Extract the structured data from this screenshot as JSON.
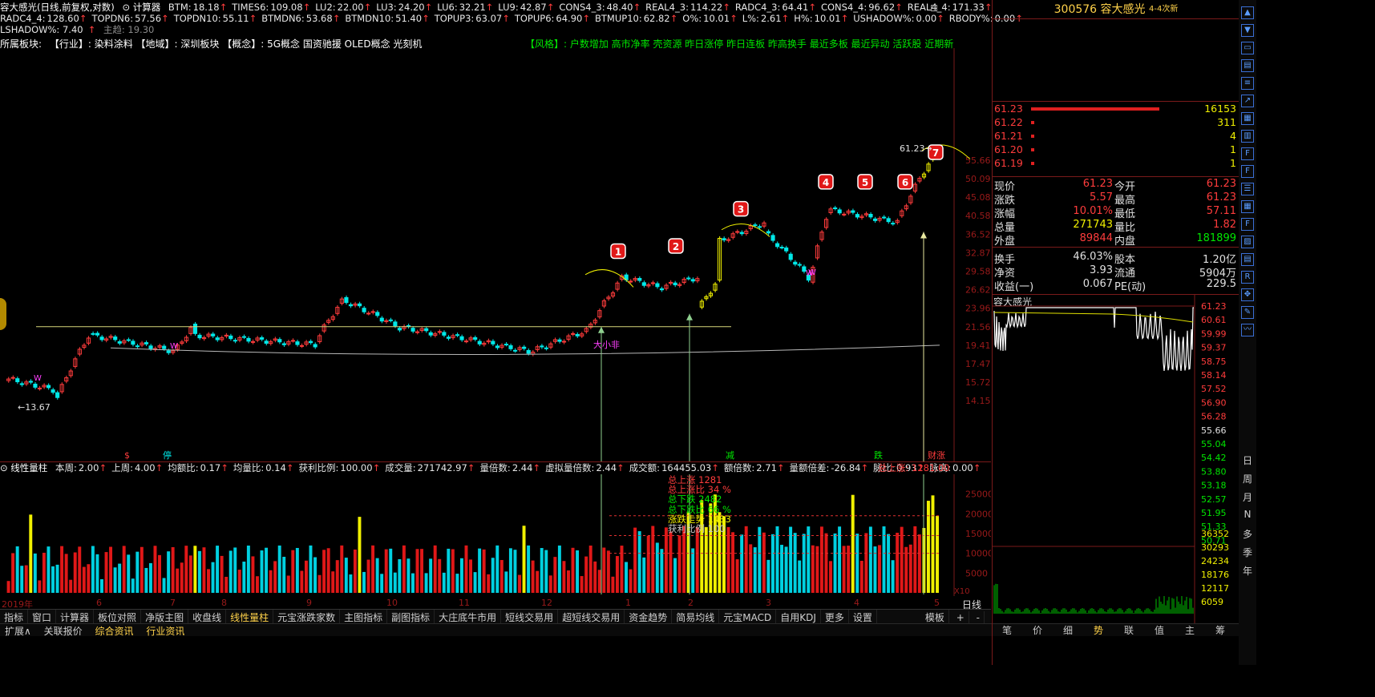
{
  "header": {
    "title": "容大感光(日线,前复权,对数)",
    "calc_label": "计算器",
    "line1": [
      {
        "name": "BTM:",
        "value": "18.18"
      },
      {
        "name": "TIMES6:",
        "value": "109.08"
      },
      {
        "name": "LU2:",
        "value": "22.00"
      },
      {
        "name": "LU3:",
        "value": "24.20"
      },
      {
        "name": "LU6:",
        "value": "32.21"
      },
      {
        "name": "LU9:",
        "value": "42.87"
      },
      {
        "name": "CONS4_3:",
        "value": "48.40"
      },
      {
        "name": "REAL4_3:",
        "value": "114.22"
      },
      {
        "name": "RADC4_3:",
        "value": "64.41"
      },
      {
        "name": "CONS4_4:",
        "value": "96.62"
      },
      {
        "name": "REAL4_4:",
        "value": "171.33"
      }
    ],
    "line2": [
      {
        "name": "RADC4_4:",
        "value": "128.60"
      },
      {
        "name": "TOPDN6:",
        "value": "57.56"
      },
      {
        "name": "TOPDN10:",
        "value": "55.11"
      },
      {
        "name": "BTMDN6:",
        "value": "53.68"
      },
      {
        "name": "BTMDN10:",
        "value": "51.40"
      },
      {
        "name": "TOPUP3:",
        "value": "63.07"
      },
      {
        "name": "TOPUP6:",
        "value": "64.90"
      },
      {
        "name": "BTMUP10:",
        "value": "62.82"
      },
      {
        "name": "O%:",
        "value": "10.01"
      },
      {
        "name": "L%:",
        "value": "2.61"
      },
      {
        "name": "H%:",
        "value": "10.01"
      },
      {
        "name": "USHADOW%:",
        "value": "0.00"
      },
      {
        "name": "RBODY%:",
        "value": "0.00"
      }
    ],
    "line3_name": "LSHADOW%:",
    "line3_value": "7.40",
    "line3_extra": "主趋: 19.30",
    "sector_label": "所属板块:",
    "sector_text": "【行业】: 染料涂料 【地域】: 深圳板块 【概念】: 5G概念 国资驰援 OLED概念 光刻机",
    "style_text": "【风格】: 户数增加 高市净率 壳资源 昨日涨停 昨日连板 昨高换手 最近多板 最近异动 活跃股 近期新高 近期强"
  },
  "price_axis": [
    "55.66",
    "50.09",
    "45.08",
    "40.58",
    "36.52",
    "32.87",
    "29.58",
    "26.62",
    "23.96",
    "21.56",
    "19.41",
    "17.47",
    "15.72",
    "14.15"
  ],
  "annotations": {
    "low_label": "13.67",
    "high_label": "61.23",
    "markers": [
      "1",
      "2",
      "3",
      "4",
      "5",
      "6",
      "7"
    ],
    "bottom_tags": [
      {
        "text": "$",
        "color": "#ff3c3c"
      },
      {
        "text": "停",
        "color": "#00e8e8"
      },
      {
        "text": "减",
        "color": "#00e600"
      },
      {
        "text": "跌",
        "color": "#00e600"
      },
      {
        "text": "财涨",
        "color": "#ff3c3c"
      }
    ],
    "note": "大小非",
    "w_tags": [
      "W",
      "W",
      "W",
      "W"
    ]
  },
  "volume_header": {
    "name": "线性量柱",
    "items": [
      {
        "name": "本周:",
        "value": "2.00"
      },
      {
        "name": "上周:",
        "value": "4.00"
      },
      {
        "name": "均额比:",
        "value": "0.17"
      },
      {
        "name": "均量比:",
        "value": "0.14"
      },
      {
        "name": "获利比例:",
        "value": "100.00"
      },
      {
        "name": "成交量:",
        "value": "271742.97"
      },
      {
        "name": "量倍数:",
        "value": "2.44"
      },
      {
        "name": "虚拟量倍数:",
        "value": "2.44"
      },
      {
        "name": "成交额:",
        "value": "164455.03"
      },
      {
        "name": "额倍数:",
        "value": "2.71"
      },
      {
        "name": "量额倍差:",
        "value": "-26.84"
      },
      {
        "name": "脉比:",
        "value": "0.93"
      },
      {
        "name": "脉高:",
        "value": "0.00"
      }
    ],
    "total_up": "总上涨: 1281.00"
  },
  "volume_axis": [
    "25000",
    "20000",
    "15000",
    "10000",
    "5000"
  ],
  "volume_axis_unit": "X10",
  "volume_stats": [
    {
      "text": "总上涨 1281",
      "color": "#ff3c3c"
    },
    {
      "text": "总上涨比 34 %",
      "color": "#ff3c3c"
    },
    {
      "text": "总下跌 2482",
      "color": "#00e600"
    },
    {
      "text": "总下跌比 66 %",
      "color": "#00e600"
    },
    {
      "text": "涨跌走势 1433",
      "color": "#f0f000"
    },
    {
      "text": "获利比例 100",
      "color": "#c8c8c8"
    }
  ],
  "date_axis": [
    "2019年",
    "6",
    "7",
    "8",
    "9",
    "10",
    "11",
    "12",
    "1",
    "2",
    "3",
    "4",
    "5"
  ],
  "date_axis_right": "日线",
  "tabs": [
    "指标",
    "窗口",
    "计算器",
    "板位对照",
    "净版主图",
    "收盘线",
    "线性量柱",
    "元宝涨跌家数",
    "主图指标",
    "副图指标",
    "大庄底牛市用",
    "短线交易用",
    "超短线交易用",
    "资金趋势",
    "简易均线",
    "元宝MACD",
    "自用KDJ",
    "更多",
    "设置"
  ],
  "active_tab": "线性量柱",
  "tab_right": [
    "模板",
    "+",
    "-"
  ],
  "status": [
    "扩展∧",
    "关联报价",
    "综合资讯",
    "行业资讯"
  ],
  "quote": {
    "code": "300576",
    "name": "容大感光",
    "tag": "4-4次新",
    "orderbook": [
      {
        "price": "61.23",
        "vol": "16153",
        "bar": 1.0
      },
      {
        "price": "61.22",
        "vol": "311",
        "bar": 0.02
      },
      {
        "price": "61.21",
        "vol": "4",
        "bar": 0.01
      },
      {
        "price": "61.20",
        "vol": "1",
        "bar": 0.01
      },
      {
        "price": "61.19",
        "vol": "1",
        "bar": 0.01
      }
    ],
    "rows": [
      {
        "l1": "现价",
        "v1": "61.23",
        "c1": "#ff3c3c",
        "l2": "今开",
        "v2": "61.23",
        "c2": "#ff3c3c"
      },
      {
        "l1": "涨跌",
        "v1": "5.57",
        "c1": "#ff3c3c",
        "l2": "最高",
        "v2": "61.23",
        "c2": "#ff3c3c"
      },
      {
        "l1": "涨幅",
        "v1": "10.01%",
        "c1": "#ff3c3c",
        "l2": "最低",
        "v2": "57.11",
        "c2": "#ff3c3c"
      },
      {
        "l1": "总量",
        "v1": "271743",
        "c1": "#f0f000",
        "l2": "量比",
        "v2": "1.82",
        "c2": "#ff3c3c"
      },
      {
        "l1": "外盘",
        "v1": "89844",
        "c1": "#ff3c3c",
        "l2": "内盘",
        "v2": "181899",
        "c2": "#00e600"
      },
      {
        "l1": "换手",
        "v1": "46.03%",
        "c1": "#e0e0e0",
        "l2": "股本",
        "v2": "1.20亿",
        "c2": "#e0e0e0"
      },
      {
        "l1": "净资",
        "v1": "3.93",
        "c1": "#e0e0e0",
        "l2": "流通",
        "v2": "5904万",
        "c2": "#e0e0e0"
      },
      {
        "l1": "收益(一)",
        "v1": "0.067",
        "c1": "#e0e0e0",
        "l2": "PE(动)",
        "v2": "229.5",
        "c2": "#e0e0e0"
      }
    ],
    "mini_title": "容大感光",
    "mini_axis": [
      "61.23",
      "60.61",
      "59.99",
      "59.37",
      "58.75",
      "58.14",
      "57.52",
      "56.90",
      "56.28",
      "55.66",
      "55.04",
      "54.42",
      "53.80",
      "53.18",
      "52.57",
      "51.95",
      "51.33",
      "50.71"
    ],
    "mini_vol_axis": [
      "36352",
      "30293",
      "24234",
      "18176",
      "12117",
      "6059"
    ],
    "bottom_tabs": [
      "笔",
      "价",
      "细",
      "势",
      "联",
      "值",
      "主",
      "筹"
    ]
  },
  "side_periods": [
    "日",
    "周",
    "月",
    "N",
    "多",
    "季",
    "年"
  ]
}
